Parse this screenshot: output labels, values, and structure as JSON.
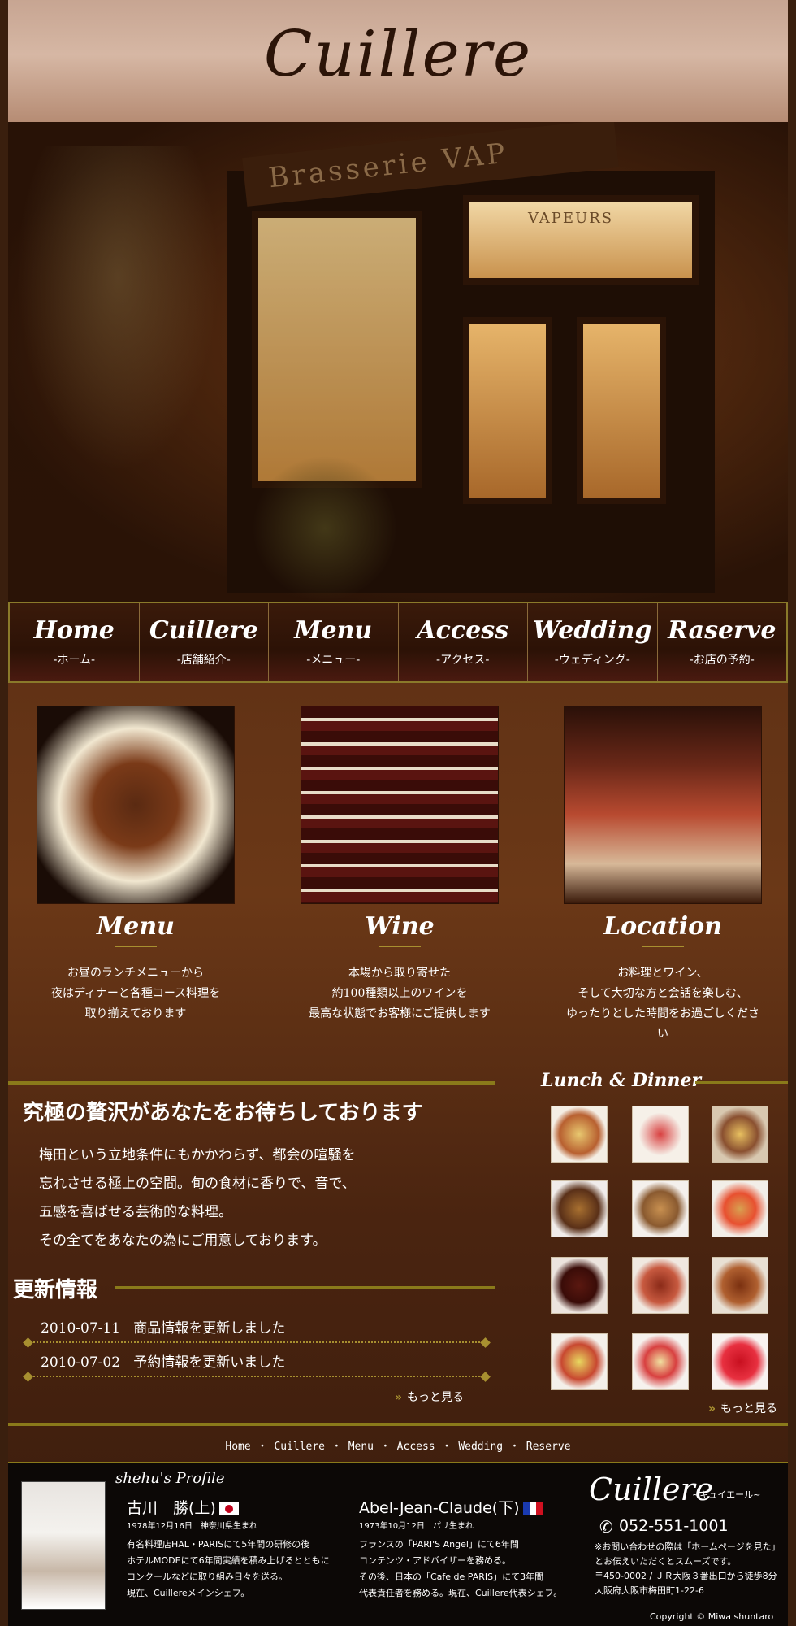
{
  "header": {
    "logo": "Cuillere"
  },
  "hero": {
    "sign": "Brasserie VAP",
    "sign2": "VAPEURS"
  },
  "nav": [
    {
      "en": "Home",
      "ja": "-ホーム-"
    },
    {
      "en": "Cuillere",
      "ja": "-店舗紹介-"
    },
    {
      "en": "Menu",
      "ja": "-メニュー-"
    },
    {
      "en": "Access",
      "ja": "-アクセス-"
    },
    {
      "en": "Wedding",
      "ja": "-ウェディング-"
    },
    {
      "en": "Raserve",
      "ja": "-お店の予約-"
    }
  ],
  "features": [
    {
      "title": "Menu",
      "lines": [
        "お昼のランチメニューから",
        "夜はディナーと各種コース料理を",
        "取り揃えております"
      ]
    },
    {
      "title": "Wine",
      "lines": [
        "本場から取り寄せた",
        "約100種類以上のワインを",
        "最高な状態でお客様にご提供します"
      ]
    },
    {
      "title": "Location",
      "lines": [
        "お料理とワイン、",
        "そして大切な方と会話を楽しむ、",
        "ゆったりとした時間をお過ごしください"
      ]
    }
  ],
  "main": {
    "slogan": "究極の贅沢があなたをお待ちしております",
    "lead": [
      "梅田という立地条件にもかかわらず、都会の喧騒を",
      "忘れさせる極上の空間。旬の食材に香りで、音で、",
      "五感を喜ばせる芸術的な料理。",
      "その全てをあなたの為にご用意しております。"
    ]
  },
  "news": {
    "title": "更新情報",
    "items": [
      {
        "date": "2010-07-11",
        "text": "商品情報を更新しました"
      },
      {
        "date": "2010-07-02",
        "text": "予約情報を更新いました"
      }
    ],
    "more": "もっと見る"
  },
  "lunch_dinner": {
    "title": "Lunch & Dinner",
    "more": "もっと見る"
  },
  "footer_nav": [
    "Home",
    "Cuillere",
    "Menu",
    "Access",
    "Wedding",
    "Reserve"
  ],
  "footer_nav_sep": "・",
  "profile": {
    "title": "shehu's Profile",
    "chef1": {
      "name": "古川　勝(上)",
      "birth": "1978年12月16日　神奈川県生まれ",
      "bio": [
        "有名料理店HAL・PARISにて5年間の研修の後",
        "ホテルMODEにて6年間実績を積み上げるとともに",
        "コンクールなどに取り組み日々を送る。",
        "現在、Cuillereメインシェフ。"
      ]
    },
    "chef2": {
      "name": "Abel-Jean-Claude(下)",
      "birth": "1973年10月12日　パリ生まれ",
      "bio": [
        "フランスの「PARI'S Angel」にて6年間",
        "コンテンツ・アドバイザーを務める。",
        "その後、日本の「Cafe de PARIS」にて3年間",
        "代表責任者を務める。現在、Cuillere代表シェフ。"
      ]
    }
  },
  "shop": {
    "logo": "Cuillere",
    "logo_sub": "~キュイエール~",
    "phone": "052-551-1001",
    "info": [
      "※お問い合わせの際は「ホームページを見た」",
      "とお伝えいただくとスムーズです。",
      "〒450-0002 /  ＪＲ大阪３番出口から徒歩8分",
      "大阪府大阪市梅田町1-22-6"
    ]
  },
  "copyright": "Copyright © Miwa shuntaro",
  "icons": {
    "phone": "phone-icon",
    "chevron": "double-chevron-icon"
  },
  "colors": {
    "accent": "#a89030",
    "logo_red": "#a01a22",
    "background": "#5c2f14"
  }
}
